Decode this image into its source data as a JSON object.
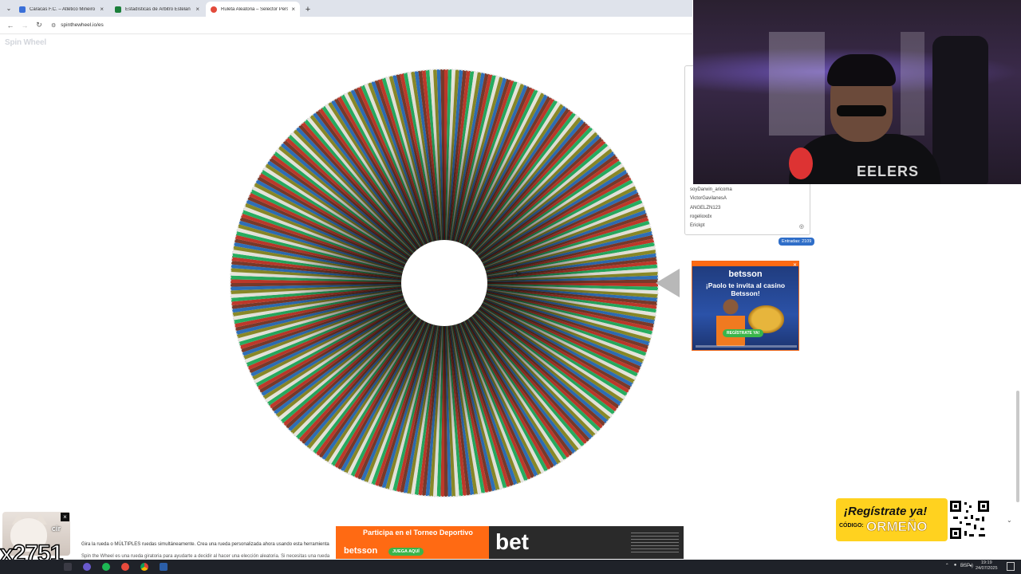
{
  "browser": {
    "tabs": [
      {
        "title": "Caracas F.C. – Atlético Mineiro ·",
        "favicon_color": "#3a6fd8",
        "active": false
      },
      {
        "title": "Estadísticas de Árbitro Estelan",
        "favicon_color": "#1b7f3a",
        "active": false
      },
      {
        "title": "Ruleta Aleatoria – Selector Pers",
        "favicon_color": "#e24a3b",
        "active": true
      }
    ],
    "close_glyph": "×",
    "new_tab_glyph": "+",
    "menu_glyph": "⌄",
    "url": "spinthewheel.io/es"
  },
  "page": {
    "logo": "Spin Wheel",
    "wheel": {
      "segment_colors": [
        "#c0392b",
        "#27ae60",
        "#e8e6de",
        "#8a8a28",
        "#2e6fb8",
        "#7a3a2a"
      ],
      "segment_count": 2109
    },
    "entries_panel": {
      "visible_entries": [
        "soyDarwin_aricoma",
        "VictorGavilanesA",
        "ANGELZN123",
        "rogelioxdx",
        "Erickpt"
      ],
      "count_label": "Entradas: 2109"
    },
    "body_text_1": "Gira la rueda o MÚLTIPLES ruedas simultáneamente. Crea una rueda personalizada ahora usando esta herramienta",
    "body_text_2": "Spin the Wheel es una rueda giratoria para ayudarte a decidir al hacer una elección aleatoria. Si necesitas una rueda"
  },
  "ads": {
    "betsson_side": {
      "brand": "betsson",
      "headline": "¡Paolo te invita al casino Betsson!",
      "cta": "REGÍSTRATE YA!"
    },
    "betsson_banner": {
      "headline": "Participa en el Torneo Deportivo",
      "brand": "betsson",
      "cta": "JUEGA AQUÍ",
      "big": "bet"
    }
  },
  "stream_overlay": {
    "webcam_shirt": "EELERS",
    "cat_word": "cir",
    "multiplier": "x2751",
    "register_title": "¡Regístrate ya!",
    "register_code_label": "CÓDIGO:",
    "register_code": "ORMEÑO"
  },
  "taskbar": {
    "lang": "ESP",
    "time": "19:19",
    "date": "24/07/2025"
  }
}
